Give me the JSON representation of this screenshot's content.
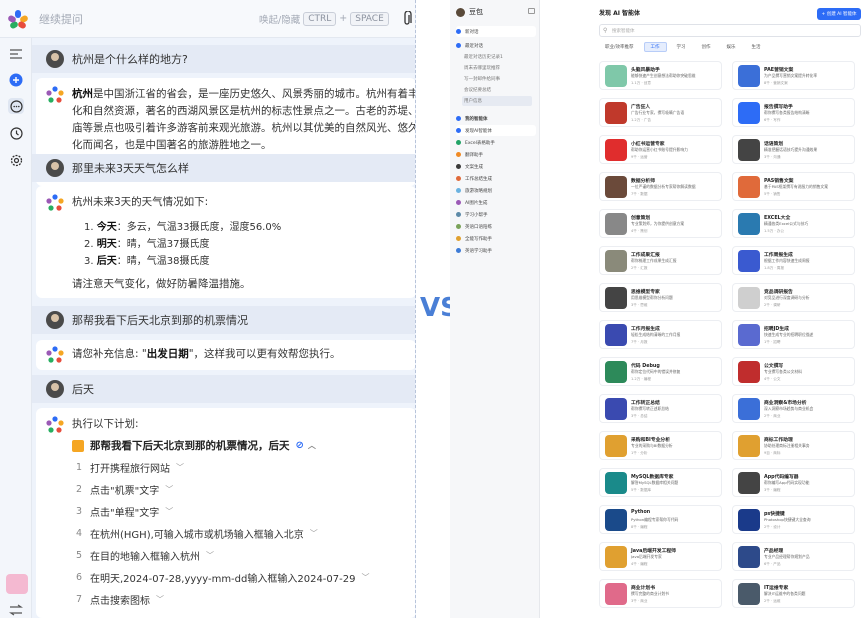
{
  "left": {
    "input_placeholder": "继续提问",
    "hint_label": "唤起/隐藏",
    "hint_key1": "CTRL",
    "hint_plus": "+",
    "hint_key2": "SPACE",
    "q1": "杭州是个什么样的地方?",
    "a1_bold": "杭州",
    "a1_lines": [
      "是中国浙江省的省会，是一座历史悠久、风景秀丽的城市。杭州有着丰富的历史",
      "化和自然资源，著名的西湖风景区是杭州的标志性景点之一。古老的苏堤、雷峰塔、",
      "庙等景点也吸引着许多游客前来观光旅游。杭州以其优美的自然风光、悠久的历史和",
      "化而闻名，也是中国著名的旅游胜地之一。"
    ],
    "q2": "那里未来3天天气怎么样",
    "a2_intro": "杭州未来3天的天气情况如下:",
    "a2_items": [
      {
        "n": "1.",
        "day": "今天",
        "desc": "：多云，气温33摄氏度，湿度56.0%"
      },
      {
        "n": "2.",
        "day": "明天",
        "desc": "：晴，气温37摄氏度"
      },
      {
        "n": "3.",
        "day": "后天",
        "desc": "：晴，气温38摄氏度"
      }
    ],
    "a2_outro": "请注意天气变化，做好防暑降温措施。",
    "q3": "那帮我看下后天北京到那的机票情况",
    "a3_pre": "请您补充信息: \"",
    "a3_bold": "出发日期",
    "a3_post": "\"，这样我可以更有效帮您执行。",
    "q4": "后天",
    "a4_intro": "执行以下计划:",
    "plan_title": "那帮我看下后天北京到那的机票情况，后天",
    "plan_steps": [
      {
        "n": "1",
        "text": "打开携程旅行网站"
      },
      {
        "n": "2",
        "text": "点击\"机票\"文字"
      },
      {
        "n": "3",
        "text": "点击\"单程\"文字"
      },
      {
        "n": "4",
        "text": "在杭州(HGH),可输入城市或机场输入框输入北京"
      },
      {
        "n": "5",
        "text": "在目的地输入框输入杭州"
      },
      {
        "n": "6",
        "text": "在明天,2024-07-28,yyyy-mm-dd输入框输入2024-07-29"
      },
      {
        "n": "7",
        "text": "点击搜索图标"
      }
    ]
  },
  "vs": "VS",
  "right": {
    "user": "豆包",
    "nav": [
      {
        "label": "新对话",
        "color": "#2d6cf6"
      },
      {
        "label": "最近对话",
        "color": "#2d6cf6"
      }
    ],
    "recent": [
      "最近对话历史记录1",
      "周末去哪里玩推荐",
      "写一封邮件给同事",
      "会议纪要总结",
      "用户信息"
    ],
    "agents_header": "我的智能体",
    "agents": [
      {
        "label": "发现AI智能体",
        "color": "#2d6cf6"
      },
      {
        "label": "Excel表格助手",
        "color": "#21a366"
      },
      {
        "label": "翻译助手",
        "color": "#f08a24"
      },
      {
        "label": "文案生成",
        "color": "#3a3a3a"
      },
      {
        "label": "工作总结生成",
        "color": "#e06a3a"
      },
      {
        "label": "旅游攻略规划",
        "color": "#6bb2e0"
      },
      {
        "label": "AI图片生成",
        "color": "#9b59b6"
      },
      {
        "label": "学习小帮手",
        "color": "#5d8aa8"
      },
      {
        "label": "英语口语陪练",
        "color": "#7aa35a"
      },
      {
        "label": "全能写作助手",
        "color": "#e0a030"
      },
      {
        "label": "英语学习助手",
        "color": "#3d7bd6"
      }
    ],
    "title": "发现 AI 智能体",
    "create": "+ 创建 AI 智能体",
    "search": "搜索智能体",
    "tabs": [
      "职业/效率推荐",
      "工作",
      "学习",
      "创作",
      "娱乐",
      "生活"
    ],
    "active_tab": 1,
    "cards": [
      {
        "title": "头脑风暴助手",
        "desc": "能够快速产生创意想法帮助你突破思维",
        "meta": "1.1万 · 创意",
        "color": "#7fc8a9"
      },
      {
        "title": "PAE营销文案",
        "desc": "为产品撰写营销文案提升转化率",
        "meta": "8千 · 营销文案",
        "color": "#3b6fd8"
      },
      {
        "title": "广告狂人",
        "desc": "广告行业专家，撰写吸睛广告语",
        "meta": "1.2万 · 广告",
        "color": "#c0392b"
      },
      {
        "title": "报告撰写助手",
        "desc": "帮你撰写各类报告结构清晰",
        "meta": "6千 · 写作",
        "color": "#2d6cf6"
      },
      {
        "title": "小红书运营专家",
        "desc": "帮助你运营小红书账号提升影响力",
        "meta": "9千 · 运营",
        "color": "#e02d2d"
      },
      {
        "title": "话语策划",
        "desc": "精准把握话语技巧提升沟通效果",
        "meta": "3千 · 沟通",
        "color": "#444444"
      },
      {
        "title": "数据分析师",
        "desc": "一位严谨的数据分析专家帮你解读数据",
        "meta": "7千 · 数据",
        "color": "#6b4a3a"
      },
      {
        "title": "PAS销售文案",
        "desc": "基于PAS框架撰写有说服力的销售文案",
        "meta": "5千 · 销售",
        "color": "#e06a3a"
      },
      {
        "title": "创意策划",
        "desc": "专业策划师，为你提供创意方案",
        "meta": "4千 · 策划",
        "color": "#888888"
      },
      {
        "title": "EXCEL大全",
        "desc": "精通各类Excel公式与技巧",
        "meta": "1.5万 · 办公",
        "color": "#2a7ab0"
      },
      {
        "title": "工作成果汇报",
        "desc": "帮你梳理工作成果生成汇报",
        "meta": "2千 · 汇报",
        "color": "#8a8a7a"
      },
      {
        "title": "工作周报生成",
        "desc": "根据工作内容快速生成周报",
        "meta": "1.8万 · 周报",
        "color": "#3a5ad0"
      },
      {
        "title": "思维模型专家",
        "desc": "用思维模型帮你分析问题",
        "meta": "3千 · 思维",
        "color": "#444444"
      },
      {
        "title": "竞品调研报告",
        "desc": "对竞品进行深度调研与分析",
        "meta": "2千 · 调研",
        "color": "#cfcfcf"
      },
      {
        "title": "工作月报生成",
        "desc": "轻松生成结构清晰的工作月报",
        "meta": "7千 · 月报",
        "color": "#3a4ab0"
      },
      {
        "title": "招聘JD生成",
        "desc": "快速生成专业的招聘职位描述",
        "meta": "1千 · 招聘",
        "color": "#5a6ad0"
      },
      {
        "title": "代码 Debug",
        "desc": "帮你定位代码中的错误并修复",
        "meta": "1.2万 · 编程",
        "color": "#2d8a5a"
      },
      {
        "title": "公文撰写",
        "desc": "专业撰写各类公文材料",
        "meta": "4千 · 公文",
        "color": "#c02d2d"
      },
      {
        "title": "工作转正总结",
        "desc": "帮你撰写转正述职总结",
        "meta": "3千 · 总结",
        "color": "#3a4ab0"
      },
      {
        "title": "商业洞察&市场分析",
        "desc": "深入洞察市场趋势与商业机会",
        "meta": "2千 · 商业",
        "color": "#3b6fd8"
      },
      {
        "title": "采购和BI专业分析",
        "desc": "专业的采购与BI数据分析",
        "meta": "1千 · 分析",
        "color": "#e0a030"
      },
      {
        "title": "商标工作助理",
        "desc": "协助处理商标注册相关事务",
        "meta": "9百 · 商标",
        "color": "#e0a030"
      },
      {
        "title": "MySQL数据库专家",
        "desc": "解答MySQL数据库相关问题",
        "meta": "5千 · 数据库",
        "color": "#1a8a8a"
      },
      {
        "title": "App代码编写器",
        "desc": "帮你编写App代码实现功能",
        "meta": "3千 · 编程",
        "color": "#444444"
      },
      {
        "title": "Python",
        "desc": "Python编程专家帮你写代码",
        "meta": "8千 · 编程",
        "color": "#1a4a8a"
      },
      {
        "title": "ps快捷键",
        "desc": "Photoshop快捷键大全查询",
        "meta": "2千 · 设计",
        "color": "#1a3a8a"
      },
      {
        "title": "Java后端开发工程师",
        "desc": "Java后端开发专家",
        "meta": "4千 · 编程",
        "color": "#e0a030"
      },
      {
        "title": "产品经理",
        "desc": "专业产品经理帮你规划产品",
        "meta": "6千 · 产品",
        "color": "#2d4a8a"
      },
      {
        "title": "商业计划书",
        "desc": "撰写完整的商业计划书",
        "meta": "3千 · 商业",
        "color": "#e06a8a"
      },
      {
        "title": "IT运维专家",
        "desc": "解决IT运维中的各类问题",
        "meta": "2千 · 运维",
        "color": "#4a5a6a"
      }
    ]
  }
}
